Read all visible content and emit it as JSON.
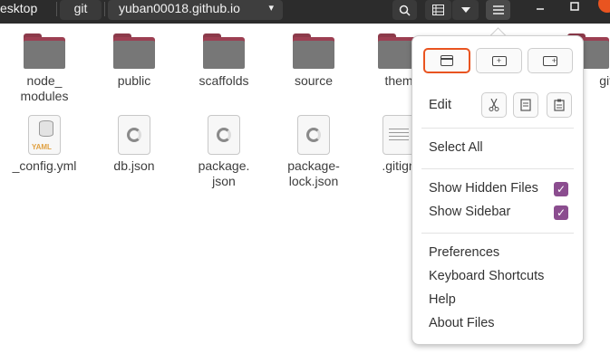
{
  "header": {
    "breadcrumbs": [
      "esktop",
      "git",
      "yuban00018.github.io"
    ],
    "dropdown_arrow": "▾",
    "icons": {
      "search": "search-icon",
      "list_view": "list-view-icon",
      "view_options": "chevron-down-icon",
      "menu": "hamburger-menu-icon",
      "minimize": "minimize-icon",
      "maximize": "maximize-icon",
      "close": "close-icon"
    }
  },
  "files": [
    {
      "name": "node_\nmodules",
      "type": "folder"
    },
    {
      "name": "public",
      "type": "folder"
    },
    {
      "name": "scaffolds",
      "type": "folder"
    },
    {
      "name": "source",
      "type": "folder"
    },
    {
      "name": "them",
      "type": "folder"
    },
    {
      "name": "git",
      "type": "folder"
    },
    {
      "name": "_config.yml",
      "type": "yaml"
    },
    {
      "name": "db.json",
      "type": "json"
    },
    {
      "name": "package.\njson",
      "type": "json"
    },
    {
      "name": "package-\nlock.json",
      "type": "json"
    },
    {
      "name": ".gitign",
      "type": "text"
    }
  ],
  "menu": {
    "top_buttons": [
      "new-window-icon",
      "new-tab-icon",
      "new-folder-icon"
    ],
    "edit_label": "Edit",
    "edit_buttons": [
      "cut-icon",
      "copy-icon",
      "paste-icon"
    ],
    "select_all": "Select All",
    "show_hidden_files": {
      "label": "Show Hidden Files",
      "checked": true
    },
    "show_sidebar": {
      "label": "Show Sidebar",
      "checked": true
    },
    "preferences": "Preferences",
    "keyboard_shortcuts": "Keyboard Shortcuts",
    "help": "Help",
    "about": "About Files"
  },
  "colors": {
    "headerbar": "#2c2c2c",
    "accent": "#e95420",
    "checkbox": "#8b4d8f",
    "folder_tab": "#9c3f52",
    "folder_body": "#777777"
  }
}
